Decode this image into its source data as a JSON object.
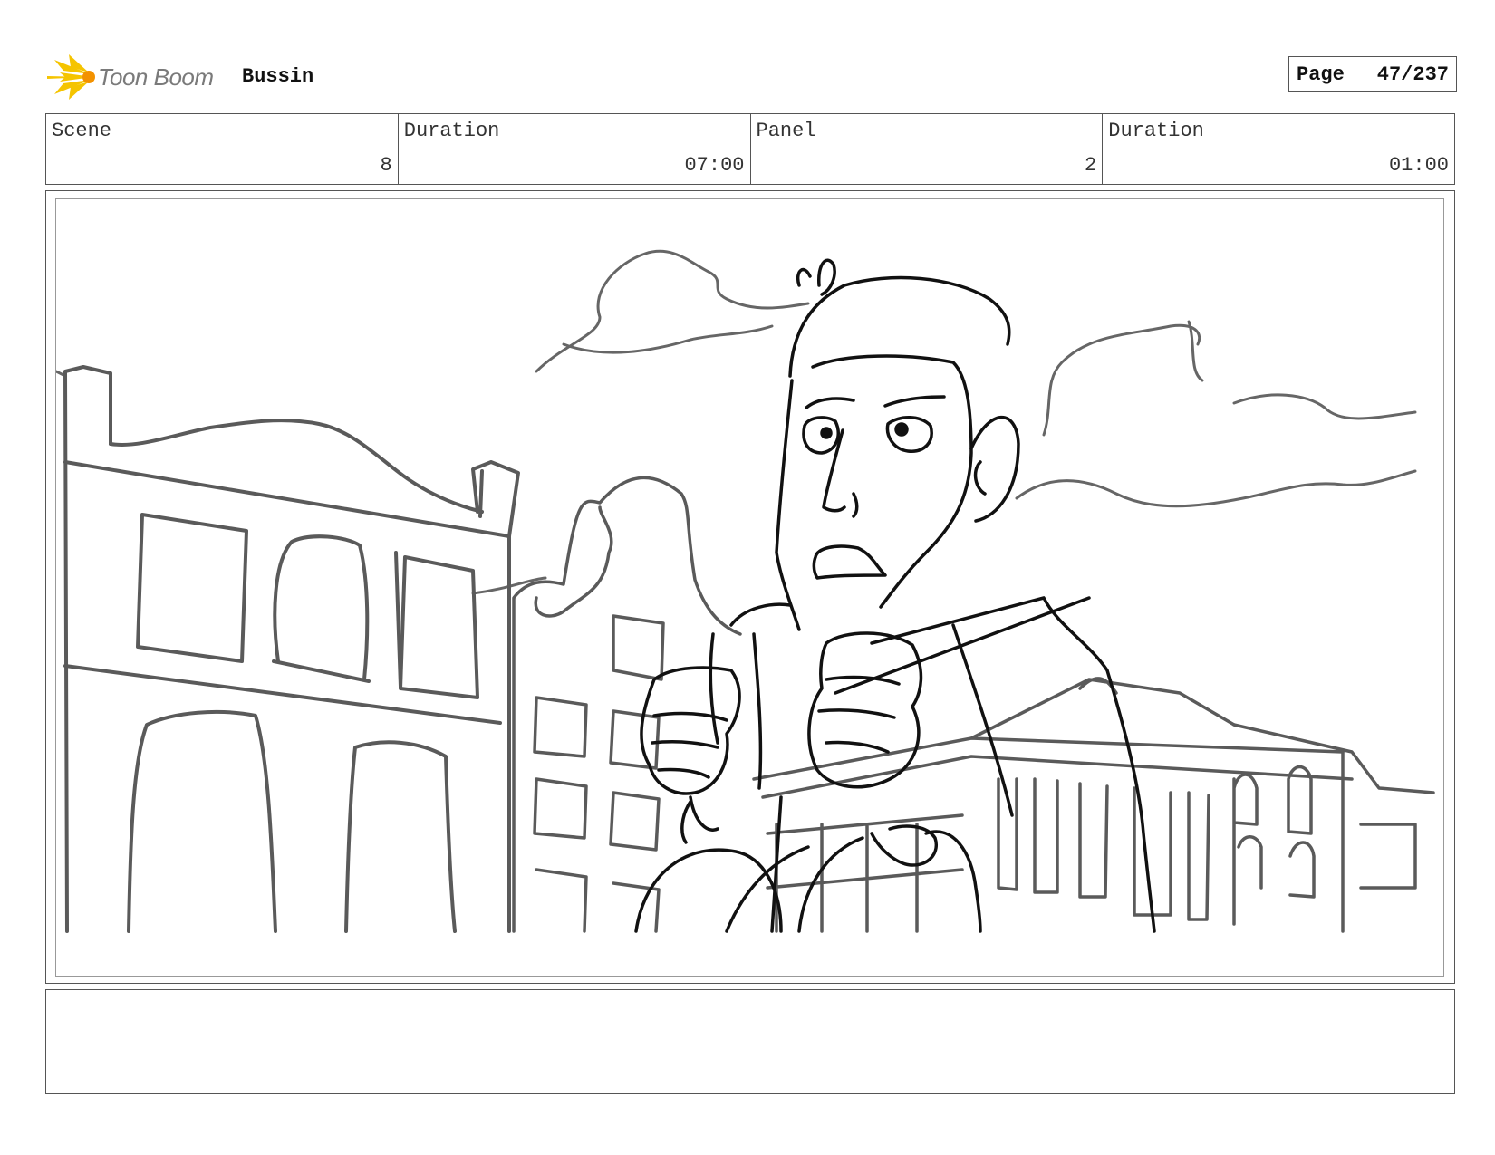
{
  "header": {
    "logo_text": "Toon Boom",
    "logo_icon": "toon-boom-burst-icon",
    "project_title": "Bussin",
    "page_label": "Page",
    "page_number": "47/237"
  },
  "info": {
    "scene_label": "Scene",
    "scene_value": "8",
    "scene_duration_label": "Duration",
    "scene_duration_value": "07:00",
    "panel_label": "Panel",
    "panel_value": "2",
    "panel_duration_label": "Duration",
    "panel_duration_value": "01:00"
  },
  "colors": {
    "logo_yellow": "#f5c400",
    "logo_orange": "#f39200",
    "sketch_ink": "#111111",
    "sketch_background_ink": "#5a5a5a"
  }
}
